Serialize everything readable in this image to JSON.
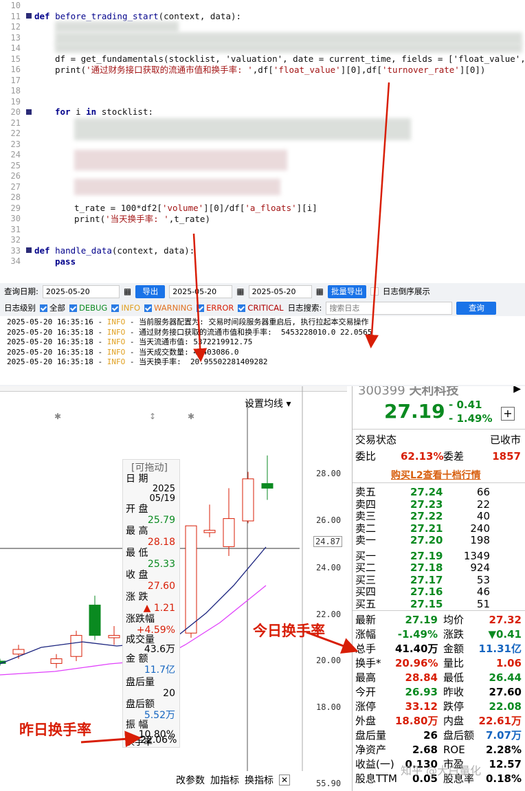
{
  "code": {
    "line_numbers": [
      "10",
      "11",
      "12",
      "13",
      "14",
      "15",
      "16",
      "17",
      "18",
      "19",
      "20",
      "21",
      "22",
      "23",
      "24",
      "25",
      "26",
      "27",
      "28",
      "29",
      "30",
      "31",
      "32",
      "33",
      "34"
    ],
    "line11_def": "def",
    "line11_name": "before_trading_start",
    "line11_rest": "(context, data):",
    "line15": "df = get_fundamentals(stocklist, 'valuation', date = current_time, fields = ['float_value','tu",
    "line16_a": "print(",
    "line16_str": "'通过财务接口获取的流通市值和换手率: '",
    "line16_b": ",df[",
    "line16_s2": "'float_value'",
    "line16_c": "][0],df[",
    "line16_s3": "'turnover_rate'",
    "line16_d": "][0])",
    "line20_for": "for",
    "line20_i": " i ",
    "line20_in": "in",
    "line20_rest": " stocklist:",
    "line29_a": "t_rate = 100*df2[",
    "line29_s1": "'volume'",
    "line29_b": "][0]/df[",
    "line29_s2": "'a_floats'",
    "line29_c": "][i]",
    "line30_a": "print(",
    "line30_str": "'当天换手率: '",
    "line30_b": ",t_rate)",
    "line33_def": "def",
    "line33_name": "handle_data",
    "line33_rest": "(context, data):",
    "line34": "pass"
  },
  "query": {
    "label": "查询日期:",
    "date1": "2025-05-20",
    "export": "导出",
    "date2": "2025-05-20",
    "date3": "2025-05-20",
    "batch_export": "批量导出",
    "reverse": "日志倒序展示"
  },
  "filter": {
    "label": "日志级别",
    "all": "全部",
    "debug": "DEBUG",
    "info": "INFO",
    "warning": "WARNING",
    "error": "ERROR",
    "critical": "CRITICAL",
    "search_label": "日志搜索:",
    "search_placeholder": "搜索日志",
    "search_button": "查询"
  },
  "logs": [
    {
      "ts": "2025-05-20 16:35:16",
      "lvl": "INFO",
      "msg": "当前服务器配置为: 交易时间段服务器重启后, 执行拉起本交易操作"
    },
    {
      "ts": "2025-05-20 16:35:18",
      "lvl": "INFO",
      "msg": "通过财务接口获取的流通市值和换手率:  5453228010.0 22.0565"
    },
    {
      "ts": "2025-05-20 16:35:18",
      "lvl": "INFO",
      "msg": "当天流通市值: 5372219912.75"
    },
    {
      "ts": "2025-05-20 16:35:18",
      "lvl": "INFO",
      "msg": "当天成交数量: 41403086.0"
    },
    {
      "ts": "2025-05-20 16:35:18",
      "lvl": "INFO",
      "msg": "当天换手率:  20.95502281409282"
    }
  ],
  "chart": {
    "ma_button": "设置均线 ▾",
    "price_labels": [
      "28.00",
      "26.00",
      "24.87",
      "24.00",
      "22.00",
      "20.00",
      "18.00",
      "55.90"
    ],
    "bottom_buttons": [
      "改参数",
      "加指标",
      "换指标"
    ],
    "candles": [
      {
        "o": 20.0,
        "c": 19.9,
        "h": 20.1,
        "l": 19.8
      },
      {
        "o": 20.3,
        "c": 20.5,
        "h": 20.7,
        "l": 20.1
      },
      {
        "o": 19.9,
        "c": 20.1,
        "h": 20.3,
        "l": 19.7
      },
      {
        "o": 20.2,
        "c": 21.1,
        "h": 21.3,
        "l": 20.0
      },
      {
        "o": 22.4,
        "c": 21.1,
        "h": 22.8,
        "l": 20.9
      },
      {
        "o": 21.0,
        "c": 21.1,
        "h": 21.5,
        "l": 20.7
      },
      {
        "o": 21.2,
        "c": 25.79,
        "h": 25.8,
        "l": 21.0
      },
      {
        "o": 25.5,
        "c": 25.6,
        "h": 26.7,
        "l": 25.3
      },
      {
        "o": 24.9,
        "c": 26.1,
        "h": 27.4,
        "l": 24.5
      },
      {
        "o": 26.0,
        "c": 27.8,
        "h": 28.1,
        "l": 25.9
      },
      {
        "o": 27.6,
        "c": 27.4,
        "h": 28.8,
        "l": 26.9
      }
    ]
  },
  "tooltip": {
    "title": "[可拖动]",
    "date_label": "日 期",
    "date_value": "2025\n05/19",
    "open_label": "开 盘",
    "open": "25.79",
    "high_label": "最 高",
    "high": "28.18",
    "low_label": "最 低",
    "low": "25.33",
    "close_label": "收 盘",
    "close": "27.60",
    "change_label": "涨 跌",
    "change": "▲ 1.21",
    "pct_label": "涨跌幅",
    "pct": "+4.59%",
    "vol_label": "成交量",
    "vol": "43.6万",
    "amt_label": "金 额",
    "amt": "11.7亿",
    "after_vol_label": "盘后量",
    "after_vol": "20",
    "after_amt_label": "盘后额",
    "after_amt": "5.52万",
    "amp_label": "振 幅",
    "amp": "10.80%",
    "turn_label": "换手率",
    "turn": "22.06%"
  },
  "annotations": {
    "today": "今日换手率",
    "yesterday": "昨日换手率"
  },
  "quote": {
    "code": "300399",
    "name": "天利科技",
    "price": "27.19",
    "chg": "- 0.41",
    "pct": "- 1.49%",
    "status_label": "交易状态",
    "status": "已收市",
    "wb_label": "委比",
    "wb": "62.13%",
    "wc_label": "委差",
    "wc": "1857",
    "l2": "购买L2查看十档行情",
    "asks": [
      [
        "卖五",
        "27.24",
        "66"
      ],
      [
        "卖四",
        "27.23",
        "22"
      ],
      [
        "卖三",
        "27.22",
        "40"
      ],
      [
        "卖二",
        "27.21",
        "240"
      ],
      [
        "卖一",
        "27.20",
        "198"
      ]
    ],
    "bids": [
      [
        "买一",
        "27.19",
        "1349"
      ],
      [
        "买二",
        "27.18",
        "924"
      ],
      [
        "买三",
        "27.17",
        "53"
      ],
      [
        "买四",
        "27.16",
        "46"
      ],
      [
        "买五",
        "27.15",
        "51"
      ]
    ],
    "stats": [
      [
        "最新",
        "27.19",
        "均价",
        "27.32"
      ],
      [
        "涨幅",
        "-1.49%",
        "涨跌",
        "▼0.41"
      ],
      [
        "总手",
        "41.40万",
        "金额",
        "11.31亿"
      ],
      [
        "换手*",
        "20.96%",
        "量比",
        "1.06"
      ],
      [
        "最高",
        "28.84",
        "最低",
        "26.44"
      ],
      [
        "今开",
        "26.93",
        "昨收",
        "27.60"
      ],
      [
        "涨停",
        "33.12",
        "跌停",
        "22.08"
      ],
      [
        "外盘",
        "18.80万",
        "内盘",
        "22.61万"
      ],
      [
        "盘后量",
        "26",
        "盘后额",
        "7.07万"
      ],
      [
        "净资产",
        "2.68",
        "ROE",
        "2.28%"
      ],
      [
        "收益(一)",
        "0.130",
        "市盈",
        "12.57"
      ],
      [
        "股息TTM",
        "0.05",
        "股息率",
        "0.18%"
      ]
    ],
    "watermark": "知乎 @大白量化"
  },
  "colors": {
    "red": "#d81e06",
    "green": "#0a8a20",
    "blue": "#1565c0",
    "info": "#e0a020"
  }
}
